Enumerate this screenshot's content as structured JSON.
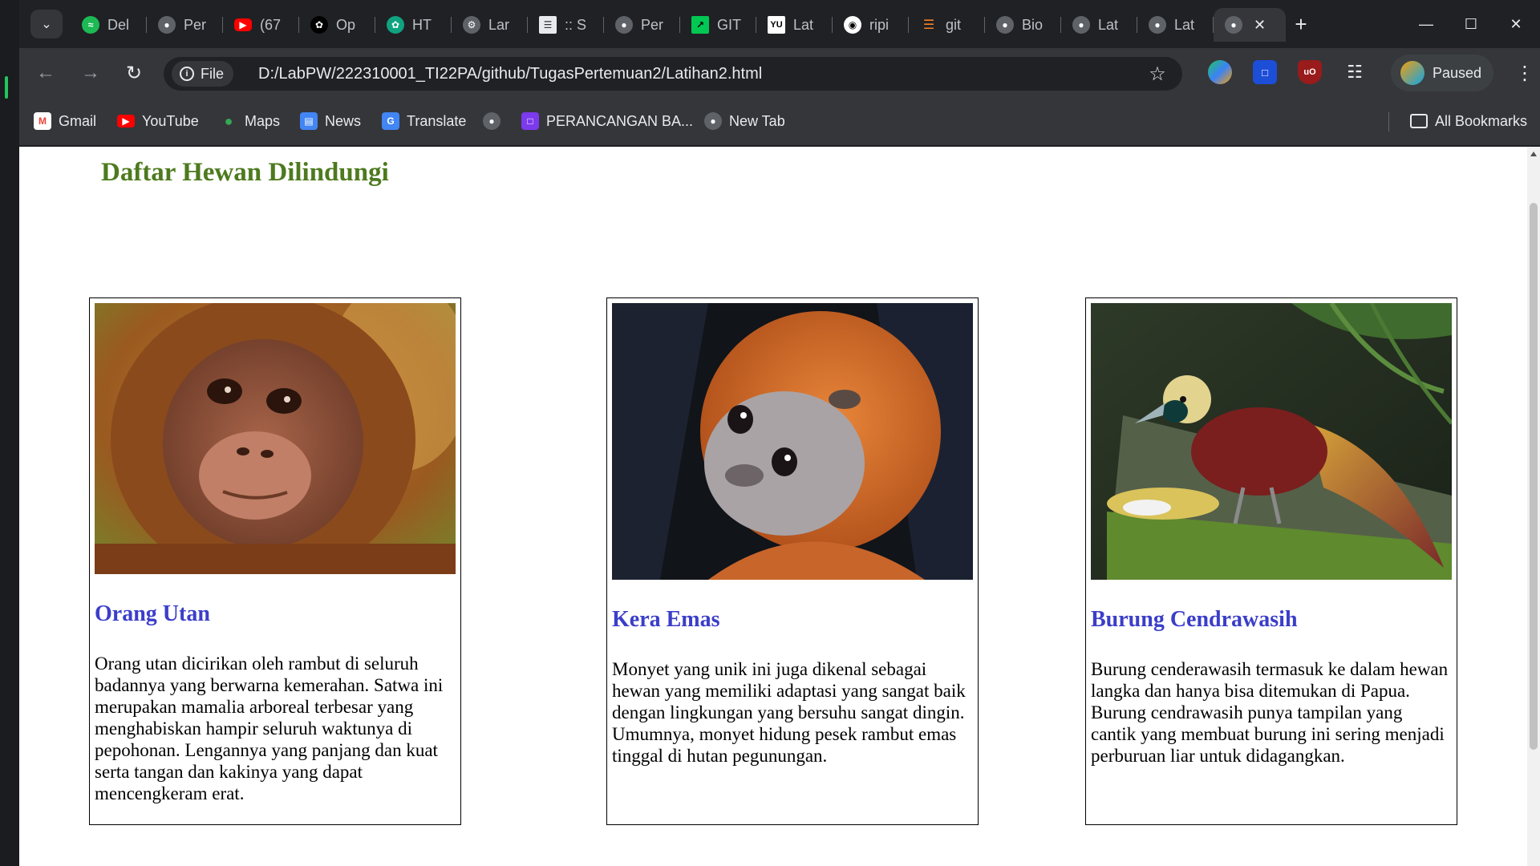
{
  "browser": {
    "tabs": [
      {
        "label": "Del",
        "icon": "spotify-icon",
        "color": "#1db954"
      },
      {
        "label": "Per",
        "icon": "globe-icon",
        "color": "#5f6368"
      },
      {
        "label": "(67",
        "icon": "youtube-icon",
        "color": "#ff0000"
      },
      {
        "label": "Op",
        "icon": "openai-icon",
        "color": "#000000"
      },
      {
        "label": "HT",
        "icon": "chatgpt-icon",
        "color": "#10a37f"
      },
      {
        "label": "Lar",
        "icon": "laravel-icon",
        "color": "#5f6368"
      },
      {
        "label": ":: S",
        "icon": "page-icon",
        "color": "#e8eaed"
      },
      {
        "label": "Per",
        "icon": "globe-icon",
        "color": "#5f6368"
      },
      {
        "label": "GIT",
        "icon": "git-icon",
        "color": "#00c853"
      },
      {
        "label": "Lat",
        "icon": "yu-icon",
        "color": "#000000"
      },
      {
        "label": "ripi",
        "icon": "github-icon",
        "color": "#000000"
      },
      {
        "label": "git",
        "icon": "stackoverflow-icon",
        "color": "#f48024"
      },
      {
        "label": "Bio",
        "icon": "globe-icon",
        "color": "#5f6368"
      },
      {
        "label": "Lat",
        "icon": "globe-icon",
        "color": "#5f6368"
      },
      {
        "label": "Lat",
        "icon": "globe-icon",
        "color": "#5f6368"
      }
    ],
    "address": {
      "scheme_label": "File",
      "url": "D:/LabPW/222310001_TI22PA/github/TugasPertemuan2/Latihan2.html"
    },
    "profile_label": "Paused",
    "bookmarks": [
      {
        "label": "Gmail",
        "icon": "gmail-icon",
        "color": "#ea4335"
      },
      {
        "label": "YouTube",
        "icon": "youtube-icon",
        "color": "#ff0000"
      },
      {
        "label": "Maps",
        "icon": "maps-icon",
        "color": "#34a853"
      },
      {
        "label": "News",
        "icon": "news-icon",
        "color": "#4285f4"
      },
      {
        "label": "Translate",
        "icon": "translate-icon",
        "color": "#4285f4"
      },
      {
        "label": "",
        "icon": "globe-icon",
        "color": "#5f6368"
      },
      {
        "label": "PERANCANGAN BA...",
        "icon": "app-icon",
        "color": "#7c3aed"
      },
      {
        "label": "New Tab",
        "icon": "globe-icon",
        "color": "#5f6368"
      }
    ],
    "all_bookmarks_label": "All Bookmarks"
  },
  "page": {
    "title": "Daftar Hewan Dilindungi",
    "cards": [
      {
        "name": "Orang Utan",
        "description": "Orang utan dicirikan oleh rambut di seluruh badannya yang berwarna kemerahan. Satwa ini merupakan mamalia arboreal terbesar yang menghabiskan hampir seluruh waktunya di pepohonan. Lengannya yang panjang dan kuat serta tangan dan kakinya yang dapat mencengkeram erat."
      },
      {
        "name": "Kera Emas",
        "description": "Monyet yang unik ini juga dikenal sebagai hewan yang memiliki adaptasi yang sangat baik dengan lingkungan yang bersuhu sangat dingin. Umumnya, monyet hidung pesek rambut emas tinggal di hutan pegunungan."
      },
      {
        "name": "Burung Cendrawasih",
        "description": "Burung cenderawasih termasuk ke dalam hewan langka dan hanya bisa ditemukan di Papua. Burung cendrawasih punya tampilan yang cantik yang membuat burung ini sering menjadi perburuan liar untuk didagangkan."
      }
    ]
  }
}
